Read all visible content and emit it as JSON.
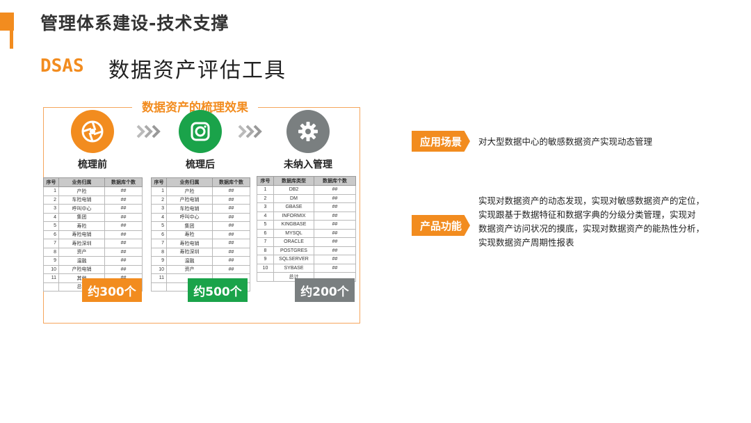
{
  "header": {
    "title": "管理体系建设-技术支撑"
  },
  "brand": {
    "name": "DSAS",
    "subtitle": "数据资产评估工具"
  },
  "effect": {
    "title": "数据资产的梳理效果",
    "stages": [
      {
        "label": "梳理前",
        "icon": "camera-aperture-icon",
        "color": "#f28c1f",
        "badge": "约300个",
        "badge_color": "#f28c1f",
        "headers": [
          "序号",
          "业务归属",
          "数据库个数"
        ],
        "rows": [
          [
            "1",
            "产险",
            "##"
          ],
          [
            "2",
            "车险电销",
            "##"
          ],
          [
            "3",
            "呼叫中心",
            "##"
          ],
          [
            "4",
            "集团",
            "##"
          ],
          [
            "5",
            "寿险",
            "##"
          ],
          [
            "6",
            "寿险电销",
            "##"
          ],
          [
            "7",
            "寿险深圳",
            "##"
          ],
          [
            "8",
            "资产",
            "##"
          ],
          [
            "9",
            "温融",
            "##"
          ],
          [
            "10",
            "产险电销",
            "##"
          ],
          [
            "11",
            "其他",
            "##"
          ],
          [
            "",
            "总计",
            ""
          ]
        ]
      },
      {
        "label": "梳理后",
        "icon": "camera-icon",
        "color": "#1aa34a",
        "badge": "约500个",
        "badge_color": "#1aa34a",
        "headers": [
          "序号",
          "业务归属",
          "数据库个数"
        ],
        "rows": [
          [
            "1",
            "产险",
            "##"
          ],
          [
            "2",
            "产险电销",
            "##"
          ],
          [
            "3",
            "车险电销",
            "##"
          ],
          [
            "4",
            "呼叫中心",
            "##"
          ],
          [
            "5",
            "集团",
            "##"
          ],
          [
            "6",
            "寿险",
            "##"
          ],
          [
            "7",
            "寿险电销",
            "##"
          ],
          [
            "8",
            "寿险深圳",
            "##"
          ],
          [
            "9",
            "温融",
            "##"
          ],
          [
            "10",
            "资产",
            "##"
          ],
          [
            "11",
            "",
            ""
          ],
          [
            "",
            "",
            ""
          ]
        ]
      },
      {
        "label": "未纳入管理",
        "icon": "gear-icon",
        "color": "#7a7f80",
        "badge": "约200个",
        "badge_color": "#7a7f80",
        "headers": [
          "序号",
          "数据库类型",
          "数据库个数"
        ],
        "rows": [
          [
            "1",
            "DB2",
            "##"
          ],
          [
            "2",
            "DM",
            "##"
          ],
          [
            "3",
            "GBASE",
            "##"
          ],
          [
            "4",
            "INFORMIX",
            "##"
          ],
          [
            "5",
            "KINGBASE",
            "##"
          ],
          [
            "6",
            "MYSQL",
            "##"
          ],
          [
            "7",
            "ORACLE",
            "##"
          ],
          [
            "8",
            "POSTGRES",
            "##"
          ],
          [
            "9",
            "SQLSERVER",
            "##"
          ],
          [
            "10",
            "SYBASE",
            "##"
          ],
          [
            "",
            "总计",
            ""
          ]
        ]
      }
    ]
  },
  "info": [
    {
      "tag": "应用场景",
      "text": "对大型数据中心的敏感数据资产实现动态管理"
    },
    {
      "tag": "产品功能",
      "lines": [
        "实现对数据资产的动态发现，实现对敏感数据资产的定位，",
        "实现跟基于数据特征和数据字典的分级分类管理，实现对",
        "数据资产访问状况的摸底，实现对数据资产的能热性分析，",
        "实现数据资产周期性报表"
      ]
    }
  ]
}
